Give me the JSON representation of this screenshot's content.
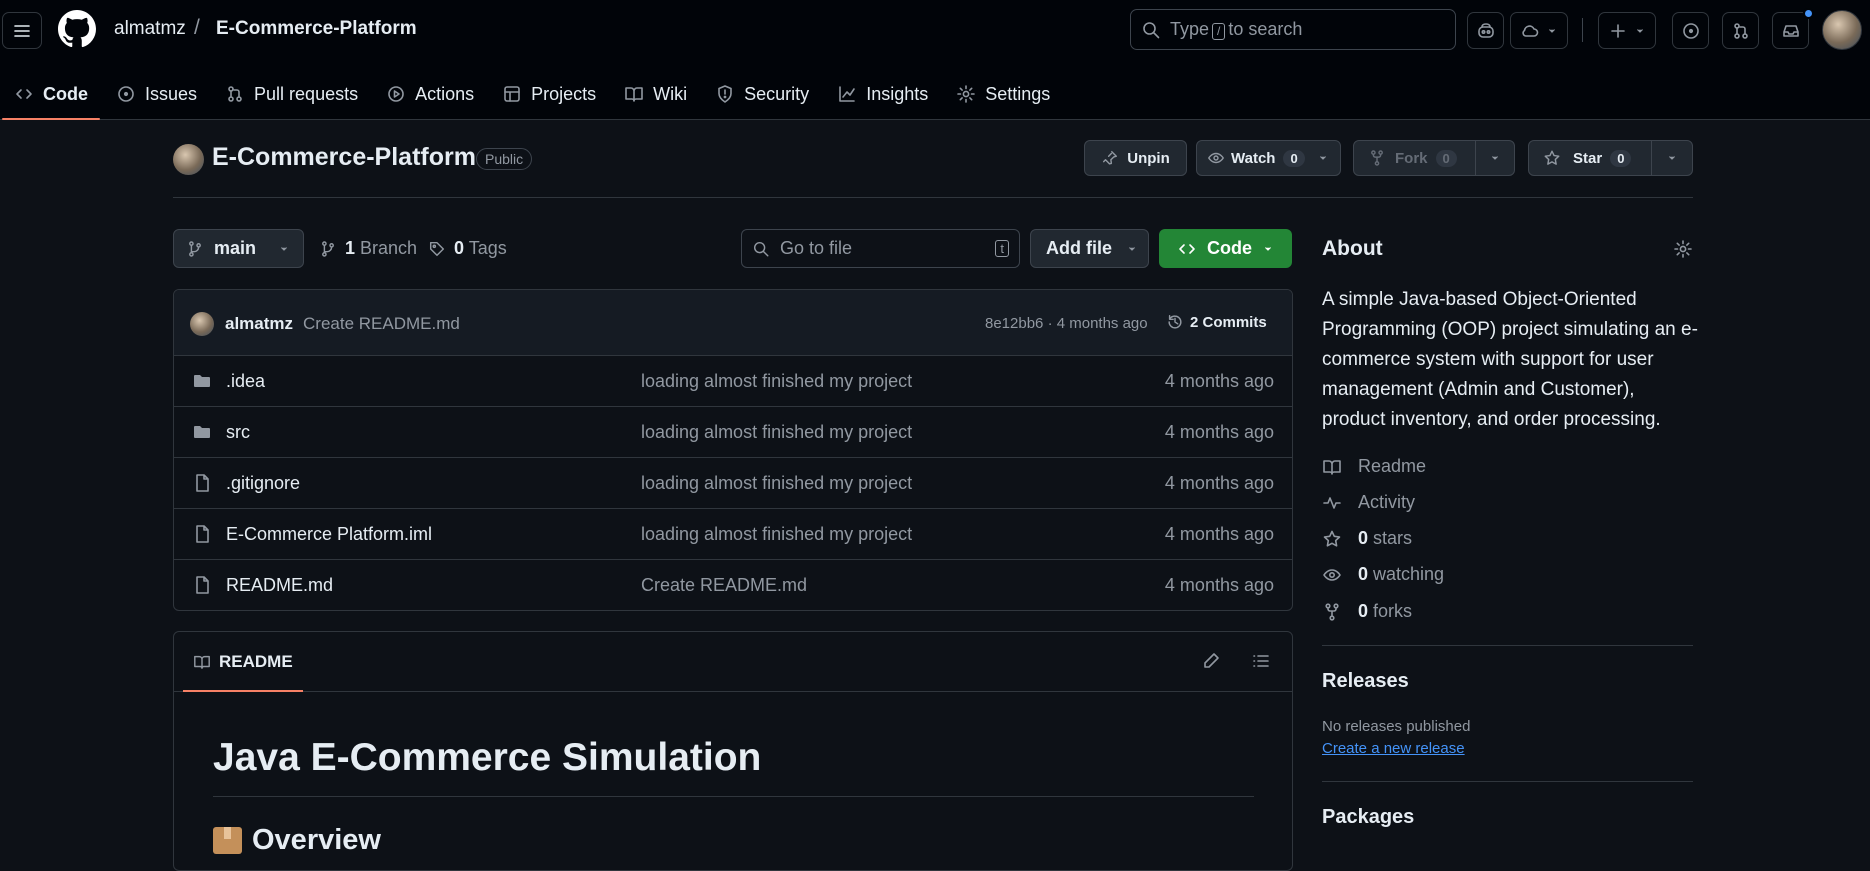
{
  "header": {
    "owner": "almatmz",
    "separator": "/",
    "repo": "E-Commerce-Platform",
    "search_pre": "Type",
    "search_key": "/",
    "search_post": "to search"
  },
  "tabs": [
    {
      "label": "Code",
      "icon": "code-icon",
      "selected": true
    },
    {
      "label": "Issues",
      "icon": "issue-icon"
    },
    {
      "label": "Pull requests",
      "icon": "pull-request-icon"
    },
    {
      "label": "Actions",
      "icon": "play-icon"
    },
    {
      "label": "Projects",
      "icon": "table-icon"
    },
    {
      "label": "Wiki",
      "icon": "book-icon"
    },
    {
      "label": "Security",
      "icon": "shield-icon"
    },
    {
      "label": "Insights",
      "icon": "graph-icon"
    },
    {
      "label": "Settings",
      "icon": "gear-icon"
    }
  ],
  "repo": {
    "title": "E-Commerce-Platform",
    "visibility": "Public",
    "unpin": "Unpin",
    "watch": "Watch",
    "watch_count": "0",
    "fork": "Fork",
    "fork_count": "0",
    "star": "Star",
    "star_count": "0"
  },
  "controls": {
    "branch": "main",
    "branch_count": "1",
    "branch_label": "Branch",
    "tag_count": "0",
    "tag_label": "Tags",
    "goto_placeholder": "Go to file",
    "goto_key": "t",
    "add_file": "Add file",
    "code": "Code"
  },
  "commit": {
    "author": "almatmz",
    "message": "Create README.md",
    "meta": "8e12bb6 · 4 months ago",
    "count": "2 Commits"
  },
  "files": [
    {
      "name": ".idea",
      "type": "folder",
      "message": "loading almost finished my project",
      "age": "4 months ago"
    },
    {
      "name": "src",
      "type": "folder",
      "message": "loading almost finished my project",
      "age": "4 months ago"
    },
    {
      "name": ".gitignore",
      "type": "file",
      "message": "loading almost finished my project",
      "age": "4 months ago"
    },
    {
      "name": "E-Commerce Platform.iml",
      "type": "file",
      "message": "loading almost finished my project",
      "age": "4 months ago"
    },
    {
      "name": "README.md",
      "type": "file",
      "message": "Create README.md",
      "age": "4 months ago"
    }
  ],
  "readme": {
    "tab": "README",
    "h1": "Java E-Commerce Simulation",
    "h2_emoji": "package-emoji",
    "h2": "Overview"
  },
  "about": {
    "title": "About",
    "description": "A simple Java-based Object-Oriented Programming (OOP) project simulating an e-commerce system with support for user management (Admin and Customer), product inventory, and order processing.",
    "readme": "Readme",
    "activity": "Activity",
    "stars_count": "0",
    "stars_label": "stars",
    "watching_count": "0",
    "watching_label": "watching",
    "forks_count": "0",
    "forks_label": "forks"
  },
  "releases": {
    "title": "Releases",
    "none": "No releases published",
    "create_link": "Create a new release"
  },
  "packages": {
    "title": "Packages"
  },
  "colors": {
    "background": "#0d1117",
    "header": "#010409",
    "accent_tab": "#f78166",
    "code_button": "#238636",
    "link": "#4493f8"
  }
}
